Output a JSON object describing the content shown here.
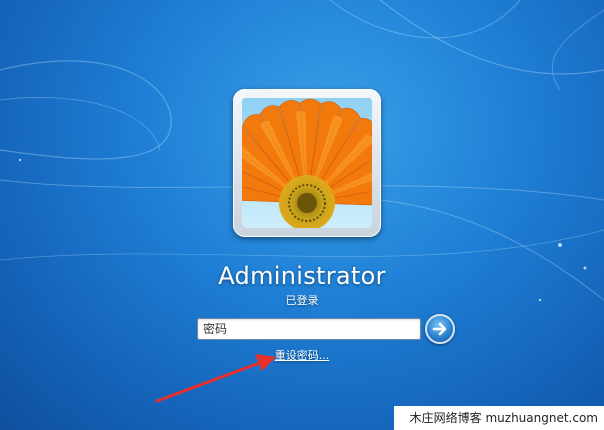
{
  "screen": {
    "background_color": "#1f7fd6"
  },
  "user": {
    "name": "Administrator",
    "status": "已登录",
    "avatar_icon": "orange-gerbera-flower"
  },
  "login": {
    "password_placeholder": "密码",
    "password_value": "",
    "submit_icon": "arrow-right-icon",
    "reset_password_link": "重设密码..."
  },
  "annotation": {
    "arrow_color": "#e8302a"
  },
  "watermark": {
    "text": "木庄网络博客 muzhuangnet.com"
  }
}
